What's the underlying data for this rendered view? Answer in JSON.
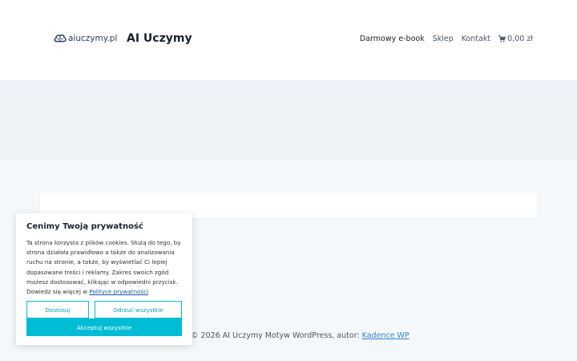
{
  "header": {
    "logo_text": "aiuczymy.pl",
    "site_title": "AI Uczymy",
    "nav": [
      {
        "label": "Darmowy e-book"
      },
      {
        "label": "Sklep"
      },
      {
        "label": "Kontakt"
      }
    ],
    "cart_label": "0,00 zł",
    "cart_icon": "shopping-cart-icon"
  },
  "footer": {
    "prefix": "© 2026 AI Uczymy Motyw WordPress, autor: ",
    "link": "Kadence WP"
  },
  "cookie_banner": {
    "title": "Cenimy Twoją prywatność",
    "body": "Ta strona korzysta z plików cookies. Służą do tego, by strona działała prawidłowo a także do analizowania ruchu na stronie, a także, by wyświetlać Ci lepiej dopasowane treści i reklamy. Zakres swoich zgód możesz dostosować, klikając w odpowiedni przycisk. Dowiedz się więcej w ",
    "link": "Polityce prywatności",
    "buttons": {
      "customize": "Dostosuj",
      "reject": "Odrzuć wszystkie",
      "accept": "Akceptuj wszystkie"
    }
  },
  "colors": {
    "accent": "#00bcd4",
    "logo_blue": "#2a3c66",
    "hero_bg": "#edf2f7",
    "page_bg": "#f5f8fb"
  }
}
